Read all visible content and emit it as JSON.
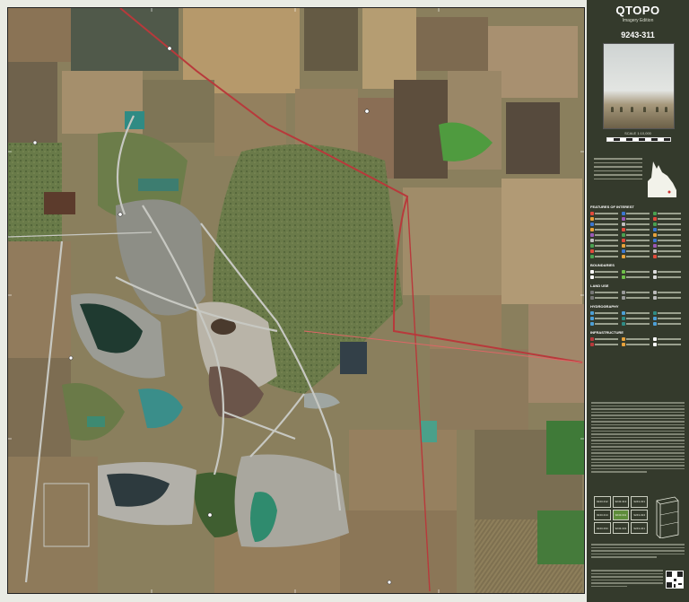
{
  "brand": "QTOPO",
  "edition": "Imagery Edition",
  "sheet_number": "9243-311",
  "scale_label": "SCALE 1:10,000",
  "legend": {
    "features_title": "FEATURES OF INTEREST",
    "boundaries_title": "BOUNDARIES",
    "land_use_title": "LAND USE",
    "hydrography_title": "HYDROGRAPHY",
    "infrastructure_title": "INFRASTRUCTURE"
  },
  "index_sheets": [
    "9243-312",
    "9243-313",
    "9243-321",
    "9243-314",
    "9243-311",
    "9243-324",
    "9243-334",
    "9243-331",
    "9243-341"
  ],
  "colors": {
    "sidebar_bg": "#343a2c",
    "frame": "#e9ebe4",
    "road": "#b8393b",
    "track": "#ffffff",
    "water": "#2f8b84",
    "current_sheet": "#5d8c3a"
  },
  "icons": {
    "locator_map": "queensland-outline-icon",
    "qr_code": "qr-code-icon",
    "block_diagram": "sheet-block-icon"
  }
}
